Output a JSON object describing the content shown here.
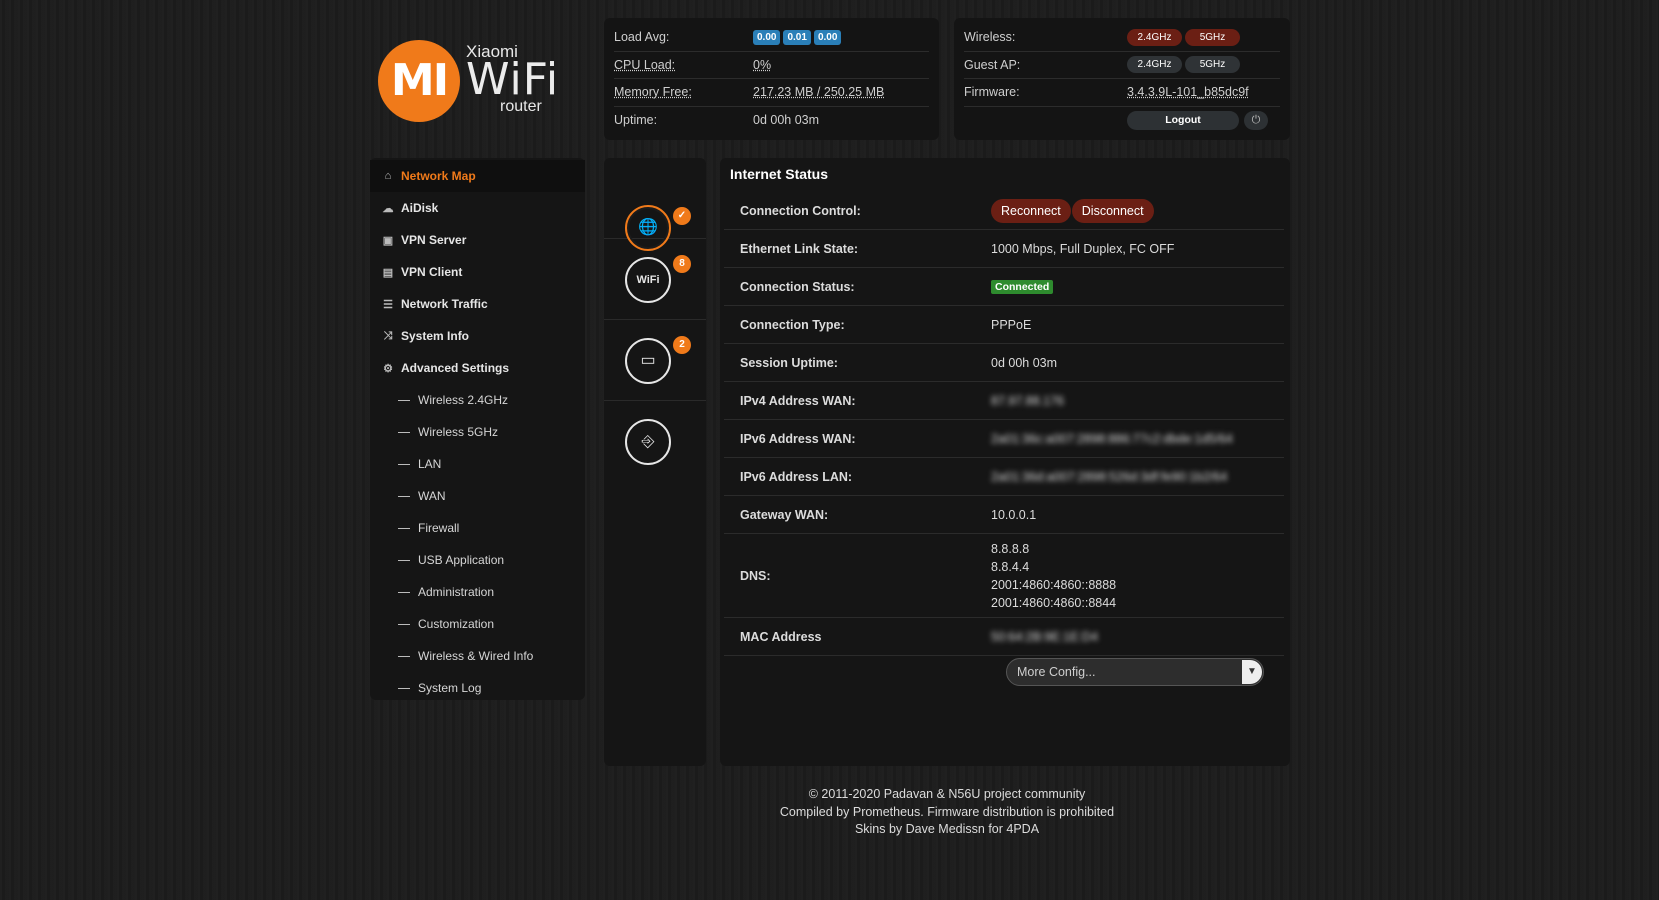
{
  "logo": {
    "mark": "MI",
    "brand": "Xiaomi",
    "product": "WiFi",
    "sub": "router"
  },
  "stats": {
    "load_avg_label": "Load Avg:",
    "load_avg": [
      "0.00",
      "0.01",
      "0.00"
    ],
    "cpu_label": "CPU Load:",
    "cpu_value": "0%",
    "mem_label": "Memory Free:",
    "mem_value": "217.23 MB / 250.25 MB",
    "uptime_label": "Uptime:",
    "uptime_value": "0d 00h 03m"
  },
  "info": {
    "wireless_label": "Wireless:",
    "wireless_24": "2.4GHz",
    "wireless_5": "5GHz",
    "guest_label": "Guest AP:",
    "guest_24": "2.4GHz",
    "guest_5": "5GHz",
    "firmware_label": "Firmware:",
    "firmware_value": "3.4.3.9L-101_b85dc9f",
    "logout_label": "Logout"
  },
  "sidebar": {
    "items": [
      {
        "label": "Network Map",
        "icon": "home-icon",
        "active": true
      },
      {
        "label": "AiDisk",
        "icon": "cloud-icon"
      },
      {
        "label": "VPN Server",
        "icon": "vpn-server-icon"
      },
      {
        "label": "VPN Client",
        "icon": "vpn-client-icon"
      },
      {
        "label": "Network Traffic",
        "icon": "traffic-icon"
      },
      {
        "label": "System Info",
        "icon": "shuffle-icon"
      },
      {
        "label": "Advanced Settings",
        "icon": "gear-icon"
      }
    ],
    "sub_items": [
      "Wireless 2.4GHz",
      "Wireless 5GHz",
      "LAN",
      "WAN",
      "Firewall",
      "USB Application",
      "Administration",
      "Customization",
      "Wireless & Wired Info",
      "System Log"
    ]
  },
  "status_icons": {
    "internet_badge": "✓",
    "wifi_label": "WiFi",
    "wifi_count": "8",
    "clients_count": "2"
  },
  "main": {
    "title": "Internet Status",
    "connection_control_label": "Connection Control:",
    "reconnect_label": "Reconnect",
    "disconnect_label": "Disconnect",
    "ethernet_label": "Ethernet Link State:",
    "ethernet_value": "1000 Mbps, Full Duplex, FC OFF",
    "conn_status_label": "Connection Status:",
    "conn_status_value": "Connected",
    "conn_type_label": "Connection Type:",
    "conn_type_value": "PPPoE",
    "session_label": "Session Uptime:",
    "session_value": "0d 00h 03m",
    "ipv4_wan_label": "IPv4 Address WAN:",
    "ipv4_wan_value": "87.97.88.176",
    "ipv6_wan_label": "IPv6 Address WAN:",
    "ipv6_wan_value": "2a01:36c:a007:2898:886:77c2:dbde:1d5/64",
    "ipv6_lan_label": "IPv6 Address LAN:",
    "ipv6_lan_value": "2a01:36d:a007:2898:526d:3df:fe90:1b2/64",
    "gateway_label": "Gateway WAN:",
    "gateway_value": "10.0.0.1",
    "dns_label": "DNS:",
    "dns_values": [
      "8.8.8.8",
      "8.8.4.4",
      "2001:4860:4860::8888",
      "2001:4860:4860::8844"
    ],
    "mac_label": "MAC Address",
    "mac_value": "50:64:2B:9E:1E:D4",
    "more_config": "More Config..."
  },
  "footer": {
    "line1": "© 2011-2020 Padavan & N56U project community",
    "line2": "Compiled by Prometheus. Firmware distribution is prohibited",
    "line3": "Skins by Dave Medissn for 4PDA"
  },
  "colors": {
    "accent": "#f07a1a",
    "danger": "#6b1f14",
    "badge_blue": "#2a7fb8",
    "ok": "#2e8b2e"
  }
}
